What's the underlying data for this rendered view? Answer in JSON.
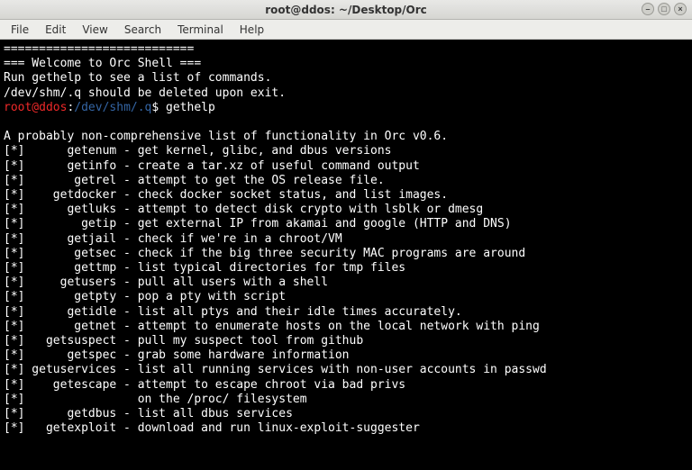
{
  "window": {
    "title": "root@ddos: ~/Desktop/Orc"
  },
  "menu": {
    "items": [
      "File",
      "Edit",
      "View",
      "Search",
      "Terminal",
      "Help"
    ]
  },
  "winbtn_glyphs": {
    "min": "–",
    "max": "□",
    "close": "×"
  },
  "terminal": {
    "banner_hr": "===========================",
    "banner_title": "=== Welcome to Orc Shell ===",
    "banner_line1": "Run gethelp to see a list of commands.",
    "banner_line2": "/dev/shm/.q should be deleted upon exit.",
    "prompt_user": "root@ddos",
    "prompt_sep": ":",
    "prompt_path": "/dev/shm/.q",
    "prompt_sym": "$ ",
    "command": "gethelp",
    "blank": "",
    "intro": "A probably non-comprehensive list of functionality in Orc v0.6.",
    "rows": [
      "[*]      getenum - get kernel, glibc, and dbus versions",
      "[*]      getinfo - create a tar.xz of useful command output",
      "[*]       getrel - attempt to get the OS release file.",
      "[*]    getdocker - check docker socket status, and list images.",
      "[*]      getluks - attempt to detect disk crypto with lsblk or dmesg",
      "[*]        getip - get external IP from akamai and google (HTTP and DNS)",
      "[*]      getjail - check if we're in a chroot/VM",
      "[*]       getsec - check if the big three security MAC programs are around",
      "[*]       gettmp - list typical directories for tmp files",
      "[*]     getusers - pull all users with a shell",
      "[*]       getpty - pop a pty with script",
      "[*]      getidle - list all ptys and their idle times accurately.",
      "[*]       getnet - attempt to enumerate hosts on the local network with ping",
      "[*]   getsuspect - pull my suspect tool from github",
      "[*]      getspec - grab some hardware information",
      "[*] getuservices - list all running services with non-user accounts in passwd",
      "[*]    getescape - attempt to escape chroot via bad privs",
      "[*]                on the /proc/ filesystem",
      "[*]      getdbus - list all dbus services",
      "[*]   getexploit - download and run linux-exploit-suggester"
    ]
  }
}
